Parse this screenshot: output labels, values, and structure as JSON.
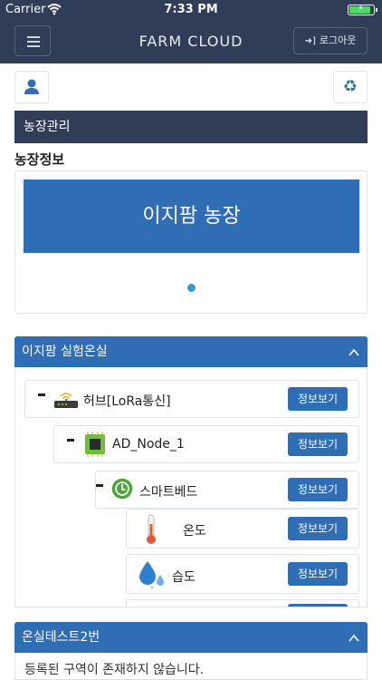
{
  "status": {
    "carrier": "Carrier",
    "time": "7:33 PM",
    "battery_level": 0.9
  },
  "navbar": {
    "title": "FARM CLOUD",
    "logout_label": "로그아웃"
  },
  "section": {
    "title": "농장관리"
  },
  "farm_info": {
    "title": "농장정보",
    "slides": [
      "이지팜 농장"
    ],
    "active_slide": 1
  },
  "greenhouses": [
    {
      "title": "이지팜 실험온실",
      "expanded": true,
      "nodes": [
        {
          "label": "허브[LoRa통신]",
          "button": "정보보기",
          "icon": "router-icon"
        },
        {
          "label": "AD_Node_1",
          "button": "정보보기",
          "icon": "chip-icon"
        },
        {
          "label": "스마트베드",
          "button": "정보보기",
          "icon": "smart-bed-icon"
        },
        {
          "label": "온도",
          "button": "정보보기",
          "icon": "thermometer-icon"
        },
        {
          "label": "습도",
          "button": "정보보기",
          "icon": "water-drop-icon"
        }
      ]
    },
    {
      "title": "온실테스트2번",
      "expanded": true,
      "empty_message": "등록된 구역이 존재하지 않습니다."
    }
  ],
  "colors": {
    "navbar": "#2f3d56",
    "accent": "#2f6db5",
    "dot": "#3a9ad9"
  }
}
